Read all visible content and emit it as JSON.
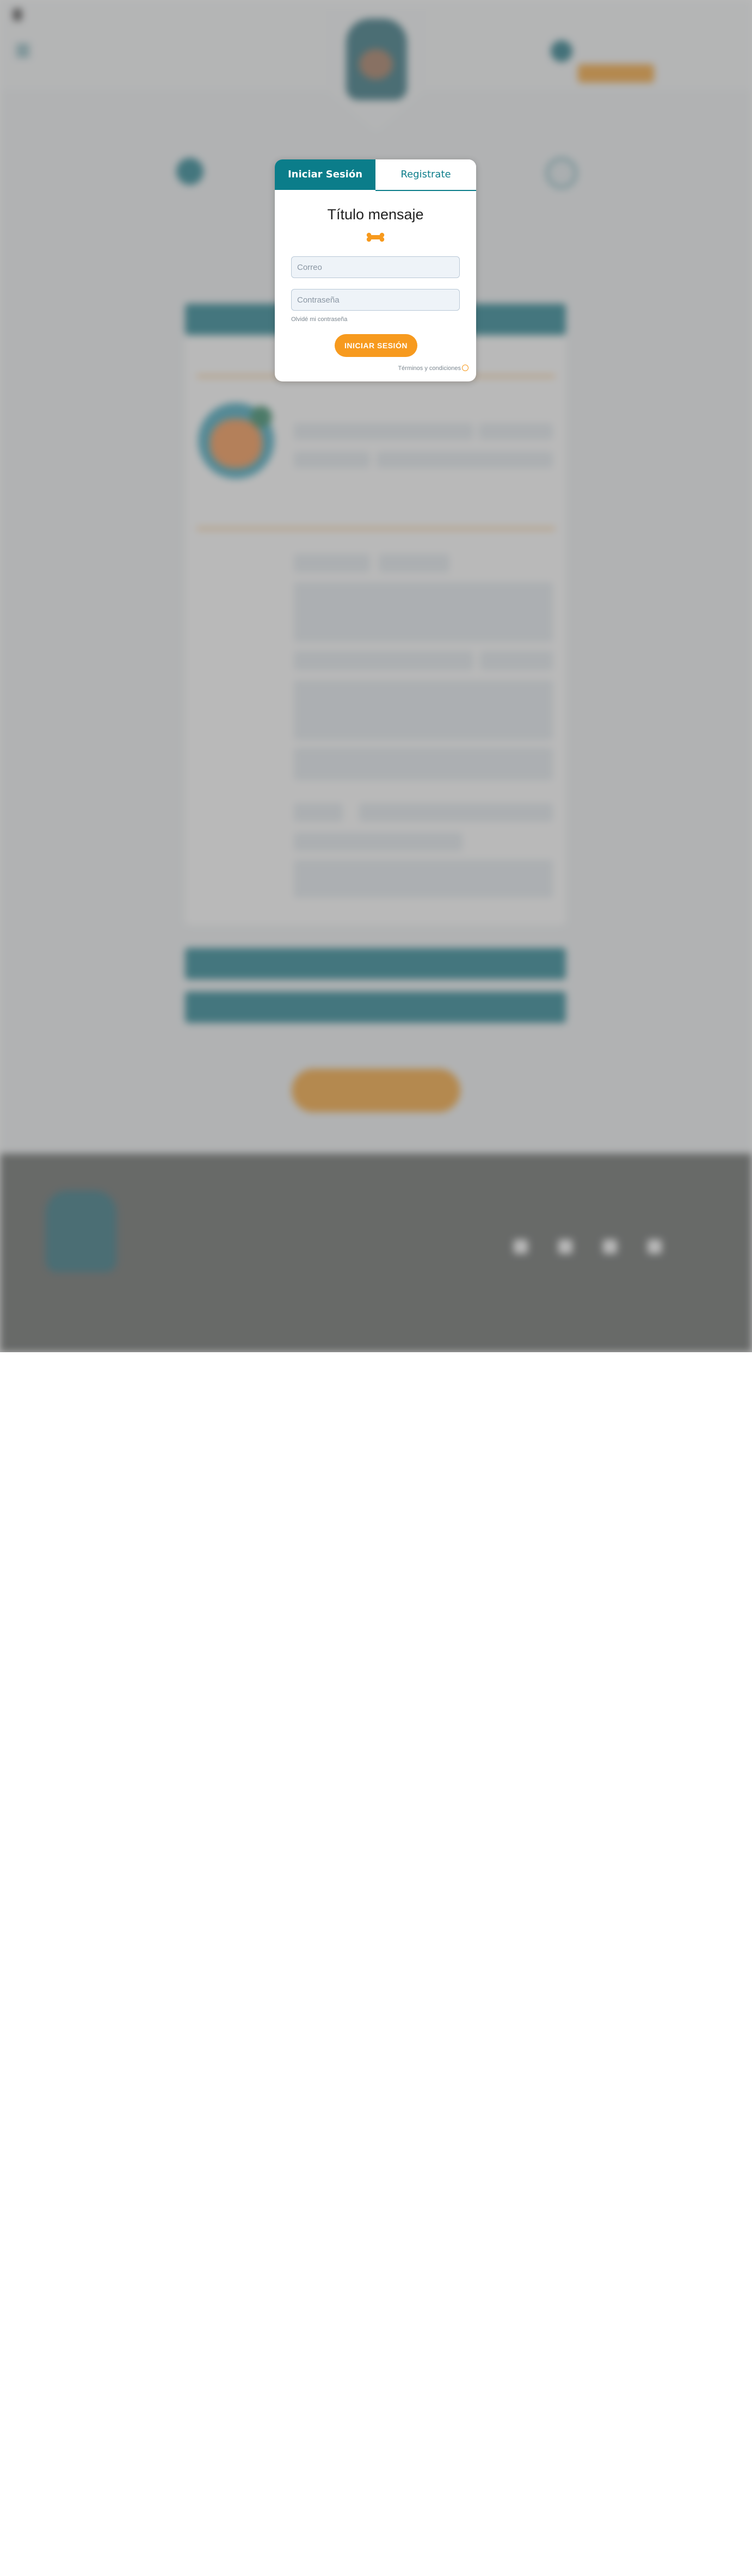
{
  "modal": {
    "tabs": [
      {
        "label": "Iniciar Sesión",
        "active": true
      },
      {
        "label": "Registrate",
        "active": false
      }
    ],
    "title": "Título mensaje",
    "email_placeholder": "Correo",
    "password_placeholder": "Contraseña",
    "forgot_label": "Olvidé mi contraseña",
    "submit_label": "INICIAR SESIÓN",
    "terms_label": "Términos y condiciones",
    "decor_icon": "bone-icon"
  },
  "colors": {
    "teal": "#0b7d8a",
    "orange": "#f79a1e",
    "overlay": "rgba(120,120,120,0.52)"
  }
}
